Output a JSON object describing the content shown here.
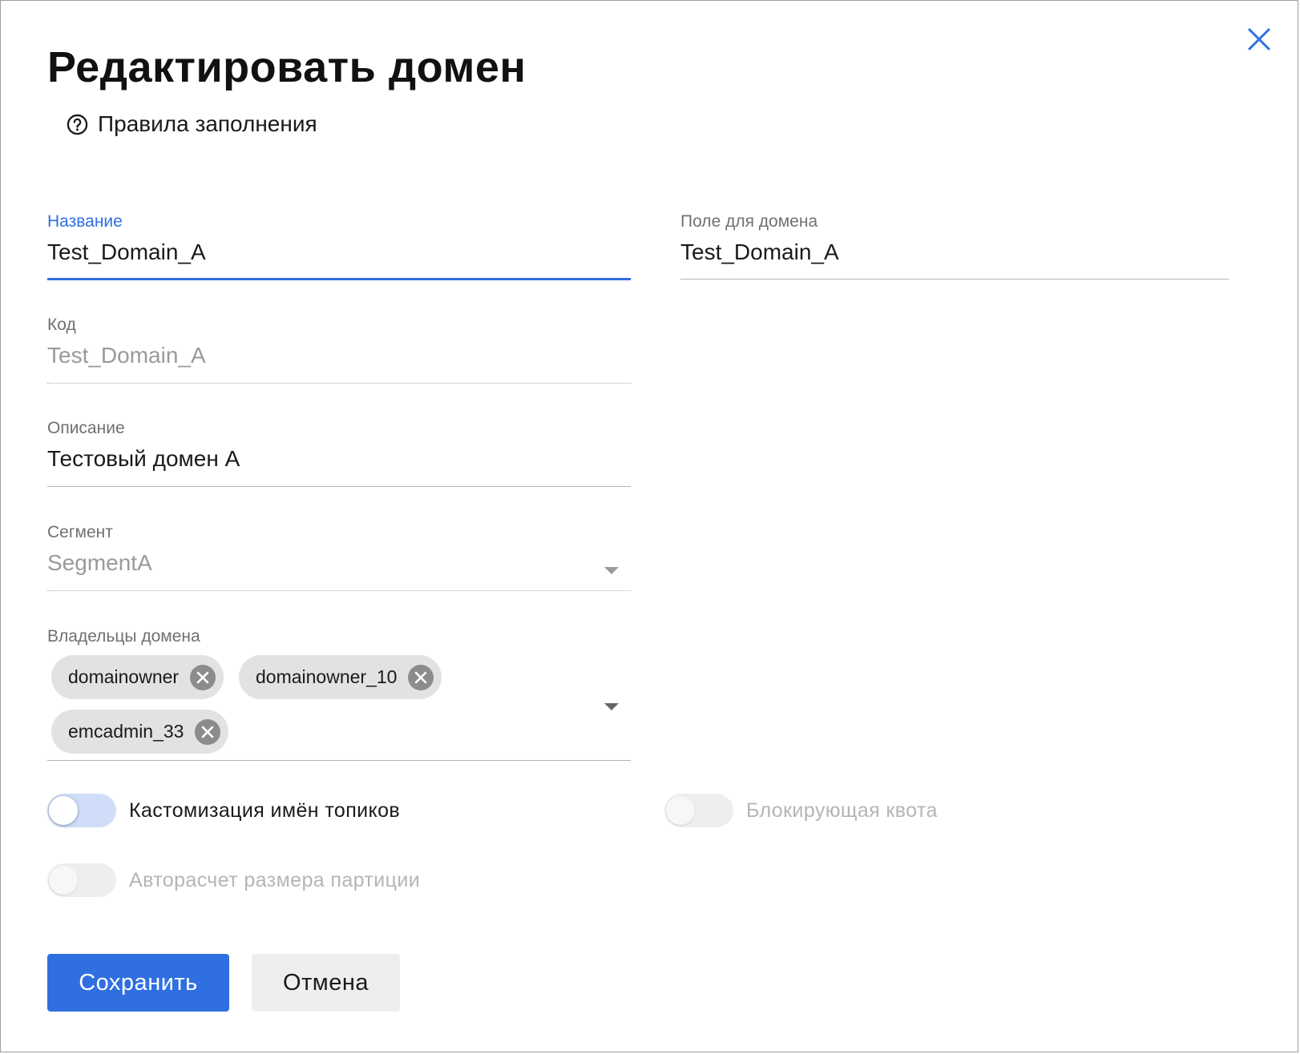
{
  "dialog": {
    "title": "Редактировать домен",
    "help_link": "Правила заполнения"
  },
  "fields": {
    "name": {
      "label": "Название",
      "value": "Test_Domain_A"
    },
    "domain_field": {
      "label": "Поле для домена",
      "value": "Test_Domain_A"
    },
    "code": {
      "label": "Код",
      "value": "Test_Domain_A"
    },
    "description": {
      "label": "Описание",
      "value": "Тестовый домен A"
    },
    "segment": {
      "label": "Сегмент",
      "value": "SegmentA"
    },
    "owners": {
      "label": "Владельцы домена",
      "chips": [
        "domainowner",
        "domainowner_10",
        "emcadmin_33"
      ]
    }
  },
  "toggles": {
    "topic_names": {
      "label": "Кастомизация имён топиков",
      "state": "off",
      "enabled": true
    },
    "blocking_quota": {
      "label": "Блокирующая квота",
      "state": "off",
      "enabled": false
    },
    "partition_autocalc": {
      "label": "Авторасчет размера партиции",
      "state": "off",
      "enabled": false
    }
  },
  "buttons": {
    "save": "Сохранить",
    "cancel": "Отмена"
  },
  "icons": {
    "close": "close-icon",
    "help": "help-circle-icon",
    "dropdown": "chevron-down-icon",
    "chip_remove": "remove-circle-icon"
  },
  "colors": {
    "accent": "#2f6fe0",
    "chip_bg": "#e2e2e2",
    "toggle_track_on": "#cfddf8",
    "disabled_text": "#b5b5b5"
  }
}
